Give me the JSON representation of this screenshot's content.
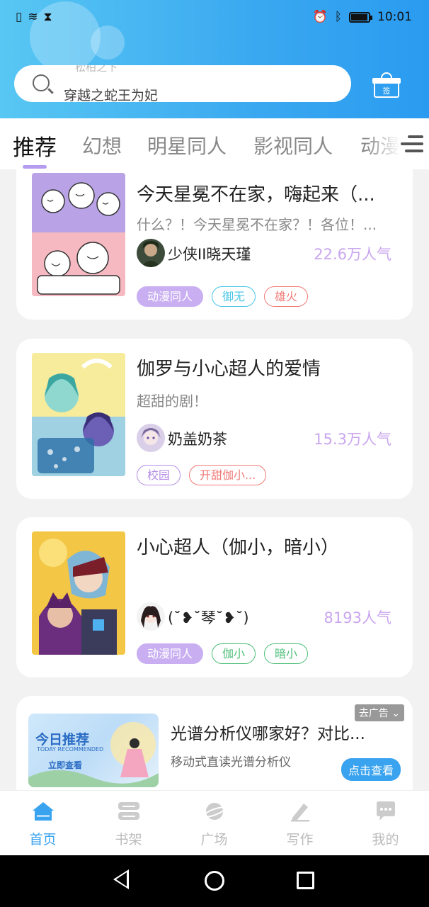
{
  "status_bar": {
    "time": "10:01",
    "battery_level": 0.9
  },
  "search": {
    "placeholder": "穿越之蛇王为妃",
    "ghost_text": "松柏之下"
  },
  "gift": {
    "label": "签"
  },
  "tabs": [
    {
      "label": "推荐",
      "active": true
    },
    {
      "label": "幻想"
    },
    {
      "label": "明星同人"
    },
    {
      "label": "影视同人"
    },
    {
      "label": "动漫"
    }
  ],
  "cards": [
    {
      "title": "今天星冕不在家，嗨起来（...",
      "desc": "什么？！今天星冕不在家？！各位！...",
      "author": "少侠II晓天瑾",
      "popularity": "22.6万人气",
      "tags": [
        {
          "label": "动漫同人",
          "style": "purple"
        },
        {
          "label": "御无",
          "style": "cyan"
        },
        {
          "label": "雄火",
          "style": "red"
        }
      ]
    },
    {
      "title": "伽罗与小心超人的爱情",
      "desc": "超甜的剧！",
      "author": "奶盖奶茶",
      "popularity": "15.3万人气",
      "tags": [
        {
          "label": "校园",
          "style": "violet"
        },
        {
          "label": "开甜伽小...",
          "style": "red"
        }
      ]
    },
    {
      "title": "小心超人（伽小，暗小）",
      "desc": "",
      "author": "(˘❥˘琴˘❥˘)",
      "popularity": "8193人气",
      "tags": [
        {
          "label": "动漫同人",
          "style": "purple"
        },
        {
          "label": "伽小",
          "style": "green"
        },
        {
          "label": "暗小",
          "style": "green"
        }
      ]
    }
  ],
  "ad": {
    "image_title": "今日推荐",
    "image_subtitle": "TODAY RECOMMENDED",
    "image_cta": "立即查看",
    "title": "光谱分析仪哪家好？对比...",
    "desc": "移动式直读光谱分析仪",
    "badge": "去广告 ⌄",
    "button": "点击查看"
  },
  "bottom_nav": [
    {
      "label": "首页",
      "icon": "home-icon",
      "active": true
    },
    {
      "label": "书架",
      "icon": "bookshelf-icon"
    },
    {
      "label": "广场",
      "icon": "planet-icon"
    },
    {
      "label": "写作",
      "icon": "pen-icon"
    },
    {
      "label": "我的",
      "icon": "chat-bubble-icon"
    }
  ],
  "colors": {
    "header_gradient": [
      "#58c7f3",
      "#2a9bf0"
    ],
    "accent": "#3aa3ef",
    "popularity": "#c9a6ef",
    "tab_indicator": "#b69cf0"
  }
}
